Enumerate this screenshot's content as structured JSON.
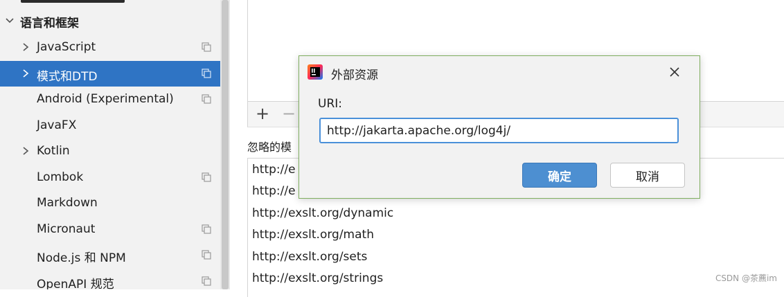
{
  "sidebar": {
    "section_label": "语言和框架",
    "items": [
      {
        "label": "JavaScript",
        "expandable": true,
        "copy_icon": true,
        "selected": false
      },
      {
        "label": "模式和DTD",
        "expandable": true,
        "copy_icon": true,
        "selected": true
      },
      {
        "label": "Android (Experimental)",
        "expandable": false,
        "copy_icon": true,
        "selected": false
      },
      {
        "label": "JavaFX",
        "expandable": false,
        "copy_icon": false,
        "selected": false
      },
      {
        "label": "Kotlin",
        "expandable": true,
        "copy_icon": false,
        "selected": false
      },
      {
        "label": "Lombok",
        "expandable": false,
        "copy_icon": true,
        "selected": false
      },
      {
        "label": "Markdown",
        "expandable": false,
        "copy_icon": false,
        "selected": false
      },
      {
        "label": "Micronaut",
        "expandable": false,
        "copy_icon": true,
        "selected": false
      },
      {
        "label": "Node.js 和 NPM",
        "expandable": false,
        "copy_icon": true,
        "selected": false
      },
      {
        "label": "OpenAPI 规范",
        "expandable": false,
        "copy_icon": true,
        "selected": false
      }
    ],
    "colors": {
      "selected_bg": "#2f74c4",
      "bg": "#f2f2f2"
    }
  },
  "main": {
    "toolbar": {
      "add_glyph": "+",
      "remove_glyph": "−"
    },
    "ignored_label": "忽略的模",
    "ignored_urls": [
      "http://e",
      "http://e",
      "http://exslt.org/dynamic",
      "http://exslt.org/math",
      "http://exslt.org/sets",
      "http://exslt.org/strings"
    ]
  },
  "dialog": {
    "title": "外部资源",
    "uri_label": "URI:",
    "uri_value": "http://jakarta.apache.org/log4j/",
    "ok_label": "确定",
    "cancel_label": "取消",
    "icons": {
      "logo": "intellij-logo-icon",
      "close": "close-icon"
    },
    "colors": {
      "ok_bg": "#4d8fd1",
      "input_border": "#4a90d9",
      "dialog_border": "#7fae5f"
    }
  },
  "watermark": "CSDN @茶藨im"
}
